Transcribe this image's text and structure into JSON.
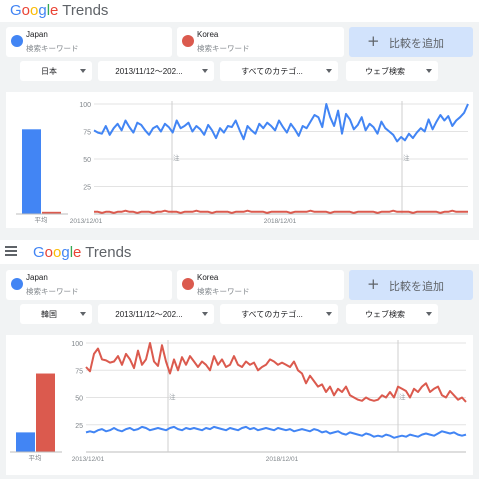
{
  "brand": {
    "google": "Google",
    "trends": "Trends"
  },
  "panels": [
    {
      "id": "top",
      "terms": [
        {
          "name": "Japan",
          "sub": "検索キーワード",
          "color": "#4285f4"
        },
        {
          "name": "Korea",
          "sub": "検索キーワード",
          "color": "#db5a4e"
        }
      ],
      "compare_label": "比較を追加",
      "filters": [
        {
          "label": "日本"
        },
        {
          "label": "2013/11/12～202..."
        },
        {
          "label": "すべてのカテゴ..."
        },
        {
          "label": "ウェブ検索"
        }
      ],
      "average_label": "平均",
      "note_label": "注",
      "chart_data": {
        "type": "line",
        "x_labels": [
          "2013/12/01",
          "2018/12/01"
        ],
        "ylim": [
          0,
          100
        ],
        "y_ticks": [
          25,
          50,
          75,
          100
        ],
        "averages": [
          {
            "name": "Japan",
            "value": 77,
            "color": "#4285f4"
          },
          {
            "name": "Korea",
            "value": 2,
            "color": "#db5a4e"
          }
        ],
        "series": [
          {
            "name": "Japan",
            "color": "#4285f4",
            "values": [
              76,
              74,
              73,
              80,
              72,
              78,
              82,
              76,
              85,
              79,
              74,
              83,
              81,
              76,
              72,
              78,
              80,
              75,
              82,
              79,
              74,
              85,
              78,
              80,
              83,
              75,
              80,
              77,
              72,
              81,
              76,
              69,
              78,
              74,
              80,
              79,
              85,
              76,
              68,
              80,
              76,
              73,
              82,
              78,
              83,
              80,
              76,
              85,
              79,
              74,
              82,
              77,
              71,
              80,
              78,
              84,
              90,
              88,
              79,
              100,
              88,
              80,
              94,
              73,
              91,
              86,
              77,
              81,
              88,
              76,
              82,
              79,
              73,
              84,
              78,
              75,
              72,
              66,
              70,
              67,
              73,
              69,
              74,
              78,
              75,
              86,
              77,
              84,
              90,
              85,
              89,
              80,
              85,
              88,
              92,
              100
            ]
          },
          {
            "name": "Korea",
            "color": "#db5a4e",
            "values": [
              2,
              2,
              1,
              2,
              2,
              1,
              2,
              2,
              3,
              2,
              2,
              1,
              2,
              2,
              2,
              1,
              2,
              2,
              3,
              2,
              2,
              2,
              1,
              2,
              2,
              2,
              3,
              2,
              2,
              2,
              1,
              2,
              2,
              2,
              2,
              1,
              2,
              2,
              2,
              3,
              2,
              2,
              2,
              2,
              1,
              2,
              2,
              2,
              2,
              2,
              1,
              2,
              2,
              2,
              2,
              3,
              2,
              2,
              2,
              2,
              1,
              2,
              2,
              2,
              2,
              2,
              1,
              2,
              2,
              2,
              2,
              2,
              1,
              2,
              2,
              2,
              3,
              2,
              2,
              2,
              2,
              1,
              2,
              2,
              2,
              2,
              2,
              2,
              1,
              2,
              2,
              3,
              2,
              2,
              2,
              2
            ]
          }
        ]
      }
    },
    {
      "id": "bottom",
      "terms": [
        {
          "name": "Japan",
          "sub": "検索キーワード",
          "color": "#4285f4"
        },
        {
          "name": "Korea",
          "sub": "検索キーワード",
          "color": "#db5a4e"
        }
      ],
      "compare_label": "比較を追加",
      "filters": [
        {
          "label": "韓国"
        },
        {
          "label": "2013/11/12～202..."
        },
        {
          "label": "すべてのカテゴ..."
        },
        {
          "label": "ウェブ検索"
        }
      ],
      "average_label": "平均",
      "note_label": "注",
      "chart_data": {
        "type": "line",
        "x_labels": [
          "2013/12/01",
          "2018/12/01"
        ],
        "ylim": [
          0,
          100
        ],
        "y_ticks": [
          25,
          50,
          75,
          100
        ],
        "averages": [
          {
            "name": "Japan",
            "value": 18,
            "color": "#4285f4"
          },
          {
            "name": "Korea",
            "value": 72,
            "color": "#db5a4e"
          }
        ],
        "series": [
          {
            "name": "Japan",
            "color": "#4285f4",
            "values": [
              18,
              19,
              18,
              20,
              21,
              19,
              20,
              22,
              20,
              19,
              21,
              22,
              20,
              21,
              23,
              22,
              20,
              21,
              22,
              21,
              20,
              22,
              23,
              21,
              20,
              22,
              21,
              22,
              21,
              20,
              22,
              21,
              23,
              22,
              21,
              20,
              22,
              21,
              20,
              22,
              23,
              21,
              22,
              20,
              21,
              22,
              21,
              20,
              22,
              21,
              20,
              21,
              19,
              20,
              21,
              20,
              19,
              21,
              20,
              18,
              19,
              17,
              18,
              19,
              17,
              16,
              18,
              17,
              16,
              15,
              17,
              16,
              14,
              15,
              14,
              16,
              15,
              13,
              14,
              15,
              14,
              16,
              15,
              14,
              16,
              17,
              16,
              15,
              17,
              19,
              18,
              17,
              18,
              16,
              15,
              16
            ]
          },
          {
            "name": "Korea",
            "color": "#db5a4e",
            "values": [
              78,
              74,
              90,
              95,
              85,
              84,
              82,
              83,
              88,
              80,
              90,
              85,
              77,
              93,
              80,
              85,
              100,
              83,
              79,
              98,
              83,
              72,
              85,
              75,
              87,
              80,
              88,
              83,
              78,
              83,
              80,
              75,
              88,
              80,
              85,
              78,
              80,
              88,
              80,
              78,
              83,
              80,
              82,
              75,
              78,
              80,
              85,
              83,
              80,
              82,
              80,
              78,
              83,
              75,
              72,
              63,
              70,
              65,
              60,
              62,
              55,
              60,
              52,
              58,
              55,
              60,
              52,
              50,
              48,
              47,
              50,
              48,
              47,
              48,
              52,
              50,
              55,
              50,
              60,
              58,
              56,
              50,
              58,
              55,
              60,
              63,
              55,
              58,
              60,
              52,
              50,
              56,
              52,
              48,
              50,
              46
            ]
          }
        ]
      }
    }
  ]
}
